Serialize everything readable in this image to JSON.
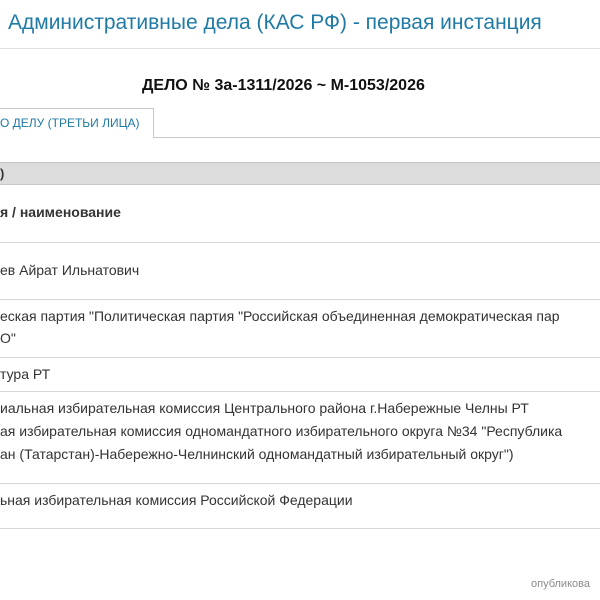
{
  "page_title": "Административные дела (КАС РФ) - первая инстанция",
  "case_number": "ДЕЛО № 3а-1311/2026 ~ М-1053/2026",
  "tab_label": "О ДЕЛУ (ТРЕТЬИ ЛИЦА)",
  "section_header": ")",
  "column_header": "я / наименование",
  "rows": [
    {
      "lines": [
        "ев Айрат Ильнатович"
      ]
    },
    {
      "lines": [
        "еская партия \"Политическая партия \"Российская объединенная демократическая пар",
        "О\""
      ]
    },
    {
      "lines": [
        "тура РТ"
      ]
    },
    {
      "lines": [
        "иальная избирательная комиссия Центрального района г.Набережные Челны РТ",
        "ая избирательная комиссия одномандатного избирательного округа №34 \"Республика",
        "ан (Татарстан)-Набережно-Челнинский одномандатный избирательный округ\")"
      ]
    },
    {
      "lines": [
        "ьная избирательная комиссия Российской Федерации"
      ]
    }
  ],
  "footer_text": "опубликова"
}
